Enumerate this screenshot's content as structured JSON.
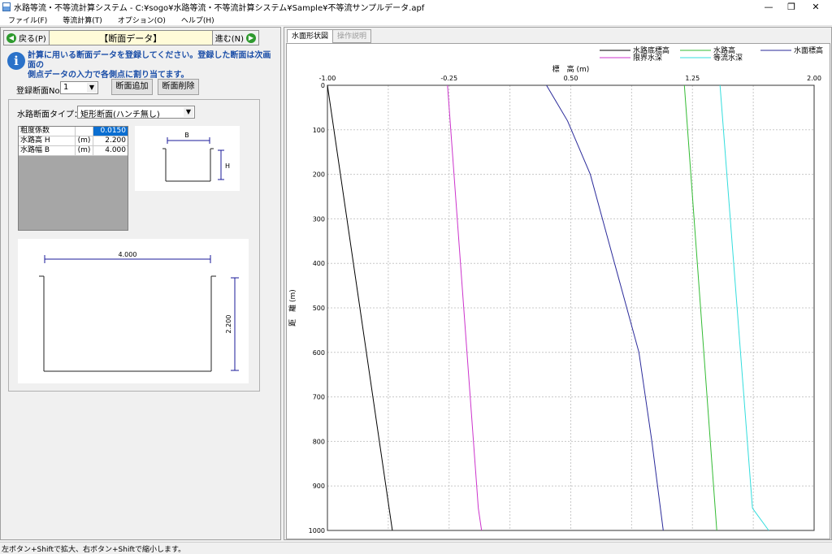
{
  "window": {
    "title": "水路等流・不等流計算システム - C:¥sogo¥水路等流・不等流計算システム¥Sample¥不等流サンプルデータ.apf",
    "minimize": "—",
    "maximize": "❐",
    "close": "✕"
  },
  "menu": [
    "ファイル(F)",
    "等流計算(T)",
    "オプション(O)",
    "ヘルプ(H)"
  ],
  "nav": {
    "back_label": "戻る(P)",
    "title": "【断面データ】",
    "next_label": "進む(N)"
  },
  "info": {
    "line1": "計算に用いる断面データを登録してください。登録した断面は次画面の",
    "line2": "側点データの入力で各側点に割り当てます。"
  },
  "form": {
    "reg_label": "登録断面No.",
    "reg_value": "1",
    "add_button": "断面追加",
    "delete_button": "断面削除",
    "type_label": "水路断面タイプ：",
    "type_value": "矩形断面(ハンチ無し)"
  },
  "params": [
    {
      "name": "粗度係数",
      "unit": "",
      "value": "0.0150"
    },
    {
      "name": "水路高 H",
      "unit": "(m)",
      "value": "2.200"
    },
    {
      "name": "水路幅 B",
      "unit": "(m)",
      "value": "4.000"
    }
  ],
  "diagram": {
    "small_b": "B",
    "small_h": "H",
    "big_width": "4.000",
    "big_height": "2.200"
  },
  "tabs": [
    "水面形状図",
    "操作説明"
  ],
  "chart_data": {
    "type": "line",
    "title": "",
    "xlabel": "標　高 (m)",
    "ylabel": "距　離 (m)",
    "xlim": [
      -1.0,
      2.0
    ],
    "ylim": [
      0,
      1000
    ],
    "x_ticks": [
      "-1.00",
      "-0.25",
      "0.50",
      "1.25",
      "2.00"
    ],
    "x_grid": [
      -1.0,
      -0.625,
      -0.25,
      0.125,
      0.5,
      0.875,
      1.25,
      1.625,
      2.0
    ],
    "y_ticks": [
      0,
      100,
      200,
      300,
      400,
      500,
      600,
      700,
      800,
      900,
      1000
    ],
    "grid": true,
    "legend": "top",
    "series": [
      {
        "name": "水路底標高",
        "color": "#000000",
        "points": [
          [
            -1.0,
            0
          ],
          [
            -0.6,
            1000
          ]
        ]
      },
      {
        "name": "水路高",
        "color": "#33bb33",
        "points": [
          [
            1.2,
            0
          ],
          [
            1.4,
            1000
          ]
        ]
      },
      {
        "name": "水面標高",
        "color": "#2a2a9a",
        "points": [
          [
            0.35,
            0
          ],
          [
            0.48,
            80
          ],
          [
            0.62,
            200
          ],
          [
            0.77,
            400
          ],
          [
            0.92,
            600
          ],
          [
            1.0,
            800
          ],
          [
            1.07,
            1000
          ]
        ]
      },
      {
        "name": "限界水深",
        "color": "#cc33cc",
        "points": [
          [
            -0.26,
            0
          ],
          [
            -0.07,
            950
          ],
          [
            -0.05,
            1000
          ]
        ]
      },
      {
        "name": "等流水深",
        "color": "#33dddd",
        "points": [
          [
            1.42,
            0
          ],
          [
            1.62,
            950
          ],
          [
            1.72,
            1000
          ]
        ]
      }
    ]
  },
  "status": "左ボタン+Shiftで拡大、右ボタン+Shiftで縮小します。"
}
